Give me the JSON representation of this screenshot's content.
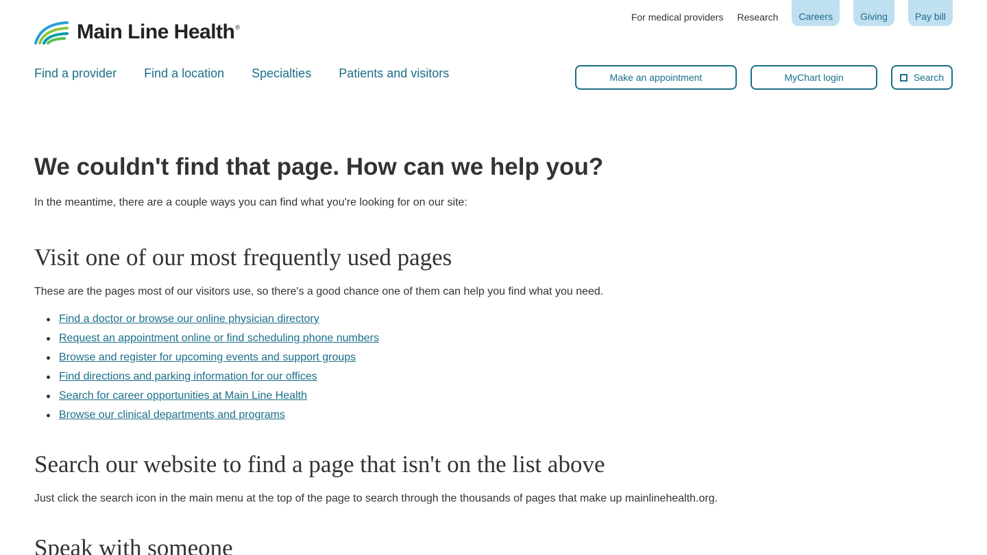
{
  "logo": {
    "text": "Main Line Health",
    "reg": "®"
  },
  "utility_nav": {
    "links": [
      "For medical providers",
      "Research"
    ],
    "pills": [
      "Careers",
      "Giving",
      "Pay bill"
    ]
  },
  "main_nav": [
    "Find a provider",
    "Find a location",
    "Specialties",
    "Patients and visitors"
  ],
  "actions": {
    "appointment": "Make an appointment",
    "mychart": "MyChart login",
    "search": "Search"
  },
  "content": {
    "title": "We couldn't find that page. How can we help you?",
    "intro": "In the meantime, there are a couple ways you can find what you're looking for on our site:",
    "section1": {
      "heading": "Visit one of our most frequently used pages",
      "desc": "These are the pages most of our visitors use, so there's a good chance one of them can help you find what you need.",
      "links": [
        "Find a doctor or browse our online physician directory",
        "Request an appointment online or find scheduling phone numbers",
        "Browse and register for upcoming events and support groups",
        "Find directions and parking information for our offices",
        "Search for career opportunities at Main Line Health",
        "Browse our clinical departments and programs"
      ]
    },
    "section2": {
      "heading": "Search our website to find a page that isn't on the list above",
      "desc": "Just click the search icon in the main menu at the top of the page to search through the thousands of pages that make up mainlinehealth.org."
    },
    "section3": {
      "heading": "Speak with someone"
    }
  },
  "colors": {
    "brand_teal": "#1a6e8a",
    "pill_bg": "#bfe0f0",
    "text": "#333333"
  }
}
